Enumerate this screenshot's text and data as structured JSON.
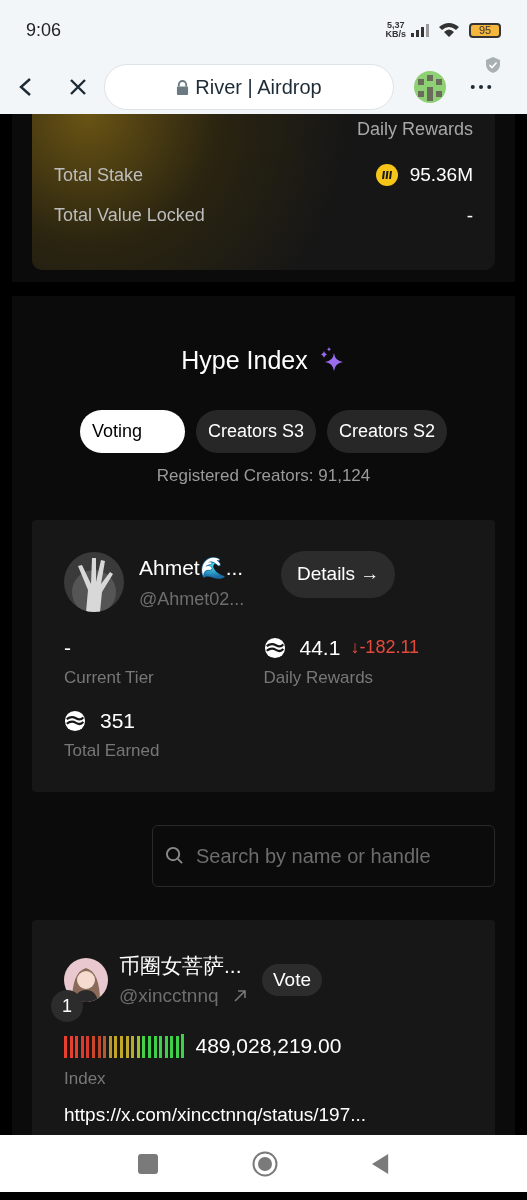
{
  "status_bar": {
    "time": "9:06",
    "speed": "5,37",
    "speed_unit": "KB/s",
    "battery": "95"
  },
  "browser": {
    "title": "River | Airdrop"
  },
  "stake_card": {
    "top_label": "Daily Rewards",
    "rows": [
      {
        "label": "Total Stake",
        "value": "95.36M",
        "coin": true
      },
      {
        "label": "Total Value Locked",
        "value": "-",
        "coin": false
      }
    ]
  },
  "hype": {
    "title": "Hype Index",
    "tabs": [
      {
        "label": "Voting",
        "selected": true
      },
      {
        "label": "Creators S3",
        "selected": false
      },
      {
        "label": "Creators S2",
        "selected": false
      }
    ],
    "registered": "Registered Creators: 91,124",
    "me": {
      "name": "Ahmet🌊...",
      "handle": "@Ahmet02...",
      "details": "Details →",
      "stats": [
        {
          "value": "-",
          "label": "Current Tier",
          "coin": false
        },
        {
          "value": "44.1",
          "change": "↓-182.11",
          "label": "Daily Rewards",
          "coin": true
        },
        {
          "value": "351",
          "label": "Total Earned",
          "coin": true
        }
      ]
    },
    "search": {
      "placeholder": "Search by name or handle"
    },
    "creators": [
      {
        "rank": "1",
        "name": "币圈女菩萨...",
        "handle": "@xincctnnq",
        "vote": "Vote",
        "index": "489,028,219.00",
        "index_label": "Index",
        "link": "https://x.com/xincctnnq/status/197..."
      }
    ]
  }
}
